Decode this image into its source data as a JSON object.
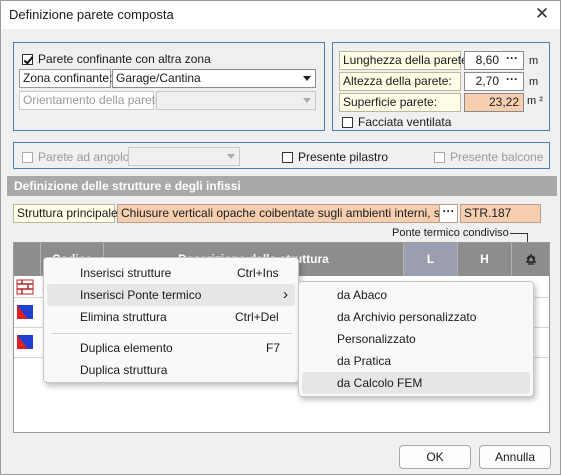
{
  "window": {
    "title": "Definizione parete composta",
    "close": "✕"
  },
  "left_group": {
    "checkbox_label": "Parete confinante con altra zona",
    "zona_label": "Zona confinante:",
    "zona_value": "Garage/Cantina",
    "orientamento_label": "Orientamento della parete:",
    "orientamento_value": ""
  },
  "right_group": {
    "lunghezza_label": "Lunghezza della parete:",
    "lunghezza_value": "8,60",
    "lunghezza_unit": "m",
    "altezza_label": "Altezza della parete:",
    "altezza_value": "2,70",
    "altezza_unit": "m",
    "superficie_label": "Superficie parete:",
    "superficie_value": "23,22",
    "superficie_unit": "m ²",
    "facciata_label": "Facciata ventilata"
  },
  "options_row": {
    "angolo_label": "Parete ad angolo",
    "pilastro_label": "Presente pilastro",
    "balcone_label": "Presente balcone"
  },
  "section": {
    "title": "Definizione delle strutture e degli infissi"
  },
  "struttura": {
    "label": "Struttura principale:",
    "value": "Chiusure verticali opache coibentate sugli ambienti interni, spessore",
    "code": "STR.187"
  },
  "ponte_label": "Ponte termico condiviso",
  "table": {
    "headers": [
      "Codice",
      "Descrizione della struttura",
      "L",
      "H"
    ],
    "rows": [
      {
        "code": "S",
        "type": "wall"
      },
      {
        "code": "I",
        "type": "window"
      },
      {
        "code": "I",
        "type": "window"
      }
    ]
  },
  "context_menu": {
    "items": [
      {
        "label": "Inserisci strutture",
        "shortcut": "Ctrl+Ins"
      },
      {
        "label": "Inserisci Ponte termico",
        "shortcut": "›"
      },
      {
        "label": "Elimina struttura",
        "shortcut": "Ctrl+Del"
      },
      {
        "label": "Duplica elemento",
        "shortcut": "F7"
      },
      {
        "label": "Duplica struttura",
        "shortcut": ""
      }
    ]
  },
  "submenu": {
    "items": [
      "da Abaco",
      "da Archivio personalizzato",
      "Personalizzato",
      "da Pratica",
      "da Calcolo FEM"
    ]
  },
  "buttons": {
    "ok": "OK",
    "cancel": "Annulla"
  },
  "colors": {
    "accent_border": "#4a7ebb",
    "highlight_orange": "#f7cfb0",
    "header_gray": "#8d8d8d"
  }
}
